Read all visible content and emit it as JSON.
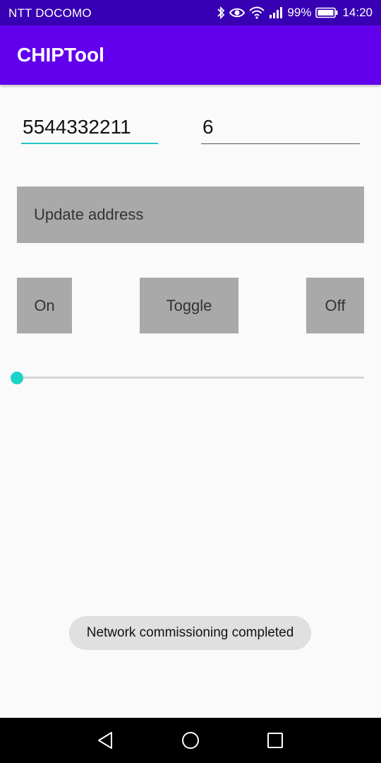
{
  "status_bar": {
    "carrier": "NTT DOCOMO",
    "battery": "99%",
    "time": "14:20",
    "icons": [
      "bluetooth-icon",
      "eye-icon",
      "wifi-icon",
      "signal-icon",
      "battery-icon"
    ]
  },
  "app_bar": {
    "title": "CHIPTool",
    "color": "#6200ee"
  },
  "form": {
    "node_id_value": "5544332211",
    "endpoint_value": "6",
    "update_address_label": "Update address"
  },
  "controls": {
    "on_label": "On",
    "toggle_label": "Toggle",
    "off_label": "Off",
    "level_slider_value": 0
  },
  "toast": {
    "message": "Network commissioning completed"
  },
  "nav_bar": {
    "icons": [
      "back-icon",
      "home-icon",
      "recents-icon"
    ]
  },
  "colors": {
    "status_bar": "#3700b3",
    "accent": "#1dd3c9",
    "button_bg": "#a9a9a9"
  }
}
